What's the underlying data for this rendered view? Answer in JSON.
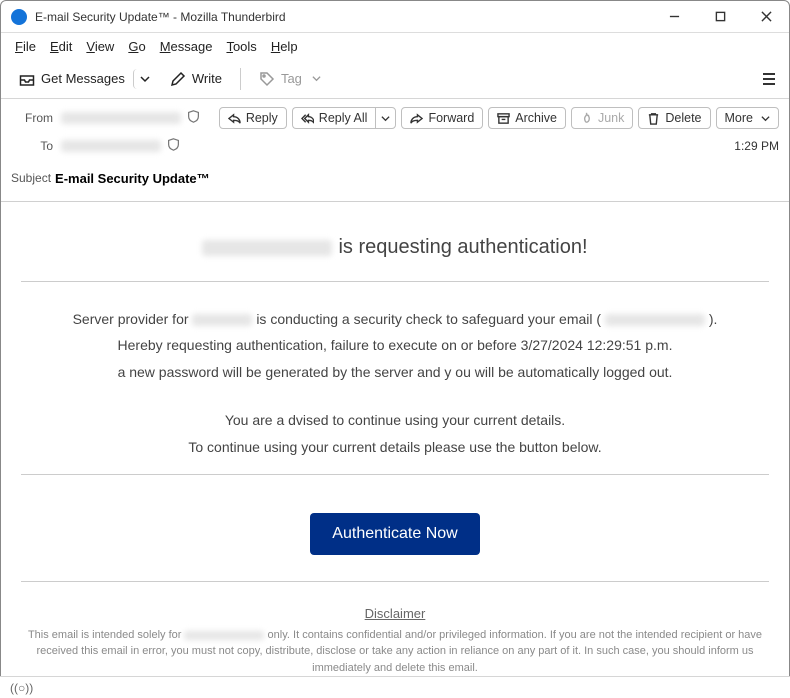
{
  "window": {
    "title": "E-mail Security Update™ - Mozilla Thunderbird"
  },
  "menu": {
    "file": "File",
    "edit": "Edit",
    "view": "View",
    "go": "Go",
    "message": "Message",
    "tools": "Tools",
    "help": "Help"
  },
  "toolbar": {
    "get_messages": "Get Messages",
    "write": "Write",
    "tag": "Tag"
  },
  "headers": {
    "from_label": "From",
    "to_label": "To",
    "subject_label": "Subject",
    "subject": "E-mail Security Update™",
    "time": "1:29 PM"
  },
  "actions": {
    "reply": "Reply",
    "reply_all": "Reply All",
    "forward": "Forward",
    "archive": "Archive",
    "junk": "Junk",
    "delete": "Delete",
    "more": "More"
  },
  "body": {
    "headline_suffix": "is requesting authentication!",
    "p1_pre": "Server provider for",
    "p1_mid": "is conducting a security check to safeguard your email (",
    "p1_post": ").",
    "p2": "Hereby requesting authentication, failure to execute on or before 3/27/2024 12:29:51 p.m.",
    "p3": "a new password will be generated by the server and y ou will be automatically logged out.",
    "p4": "You are a dvised to continue using your current details.",
    "p5": "To continue using your current details please use the button below.",
    "cta": "Authenticate Now",
    "disclaimer_head": "Disclaimer",
    "disclaimer_pre": "This email is intended solely for",
    "disclaimer_post": "only. It contains confidential and/or privileged information. If you are not the intended recipient or have received this email in error, you must not copy, distribute, disclose or take any action in reliance on any part of it. In such case, you should inform us immediately and delete this email."
  },
  "status": {
    "indicator": "((○))"
  }
}
